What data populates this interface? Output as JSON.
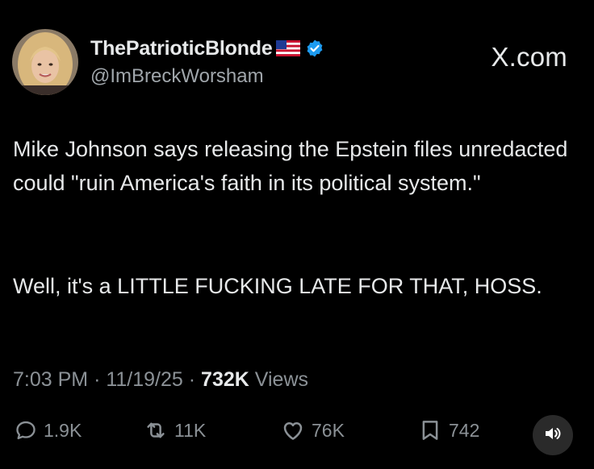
{
  "author": {
    "display_name": "ThePatrioticBlonde",
    "handle": "@ImBreckWorsham",
    "flag_icon": "us-flag-icon",
    "verified_icon": "verified-badge-icon",
    "verified_color": "#1d9bf0"
  },
  "brand": "X.com",
  "tweet": {
    "paragraphs": [
      "Mike Johnson says releasing the Epstein files unredacted could \"ruin America's faith in its political system.\"",
      "Well, it's a LITTLE FUCKING LATE FOR THAT, HOSS."
    ]
  },
  "meta": {
    "time": "7:03 PM",
    "date": "11/19/25",
    "separator": "·",
    "views_count": "732K",
    "views_label": "Views"
  },
  "actions": {
    "replies": "1.9K",
    "reposts": "11K",
    "likes": "76K",
    "bookmarks": "742"
  },
  "colors": {
    "background": "#000000",
    "text": "#e7e9ea",
    "secondary": "#8b9196"
  }
}
